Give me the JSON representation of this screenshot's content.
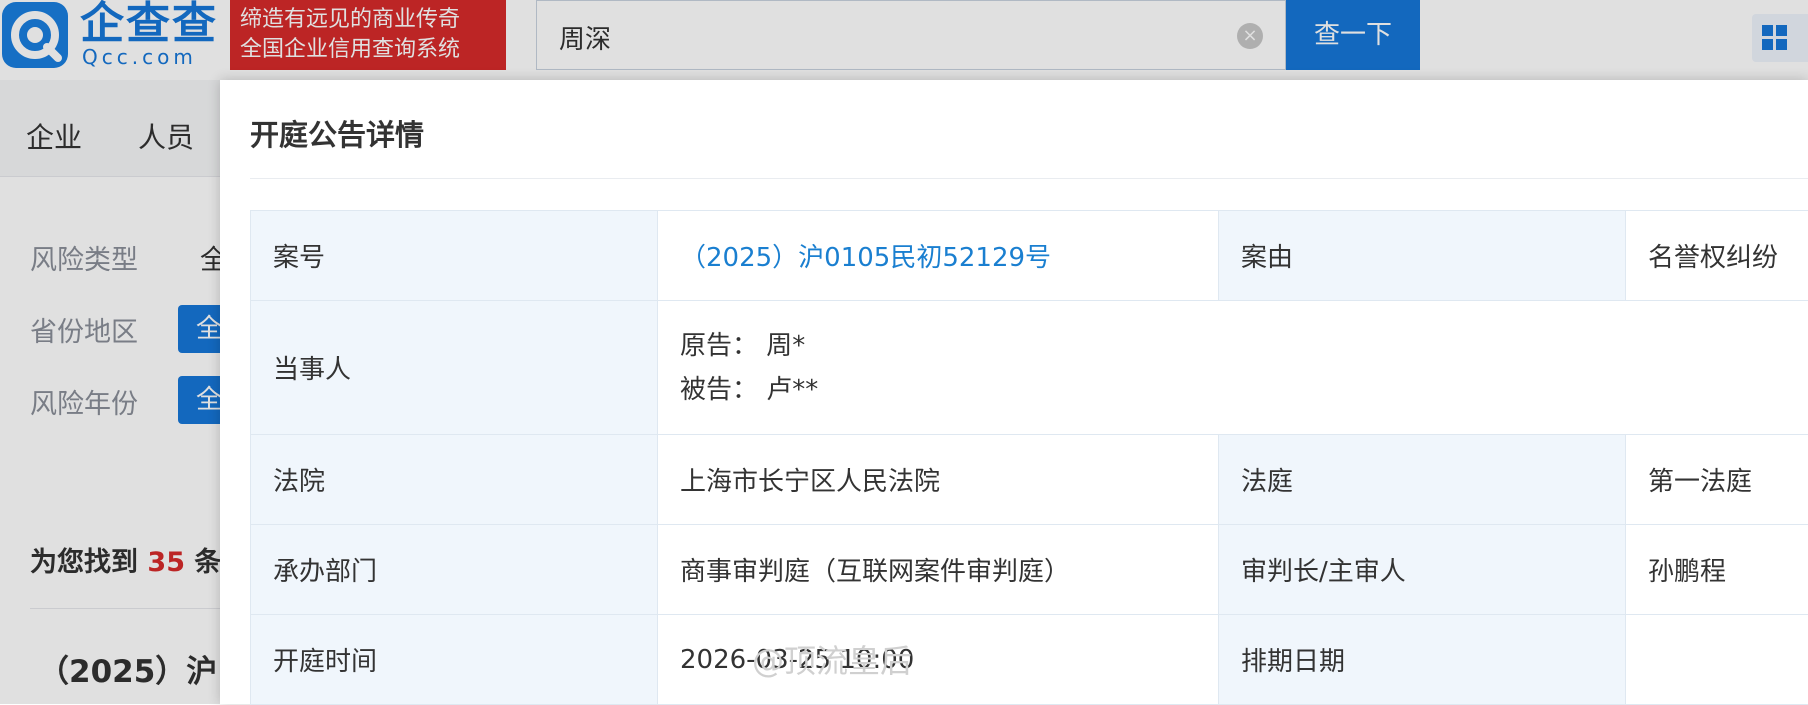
{
  "header": {
    "logo_cn": "企查查",
    "logo_en": "Qcc.com",
    "slogan_line1": "缔造有远见的商业传奇",
    "slogan_line2": "全国企业信用查询系统",
    "search_value": "周深",
    "search_button": "查一下",
    "clear_icon": "×"
  },
  "nav": {
    "tabs": [
      "企业",
      "人员"
    ]
  },
  "filters": {
    "risk_type_label": "风险类型",
    "risk_type_value": "全",
    "province_label": "省份地区",
    "province_value": "全",
    "risk_year_label": "风险年份",
    "risk_year_value": "全"
  },
  "results": {
    "count_prefix": "为您找到",
    "count": "35",
    "count_suffix": "条",
    "first_title": "（2025）沪"
  },
  "modal": {
    "title": "开庭公告详情",
    "rows": {
      "case_no_label": "案号",
      "case_no_value": "（2025）沪0105民初52129号",
      "cause_label": "案由",
      "cause_value": "名誉权纠纷",
      "parties_label": "当事人",
      "plaintiff": "原告：  周*",
      "defendant": "被告：  卢**",
      "court_label": "法院",
      "court_value": "上海市长宁区人民法院",
      "tribunal_label": "法庭",
      "tribunal_value": "第一法庭",
      "dept_label": "承办部门",
      "dept_value": "商事审判庭（互联网案件审判庭）",
      "judge_label": "审判长/主审人",
      "judge_value": "孙鹏程",
      "hearing_label": "开庭时间",
      "hearing_value": "2026-03-25 10:00",
      "schedule_label": "排期日期",
      "schedule_value": ""
    }
  },
  "watermark": {
    "text": "@顶流皇后"
  },
  "colors": {
    "brand_blue": "#1677d9",
    "slogan_red": "#d62b2b",
    "link_blue": "#1a7fd0",
    "label_bg": "#f0f6fc"
  }
}
